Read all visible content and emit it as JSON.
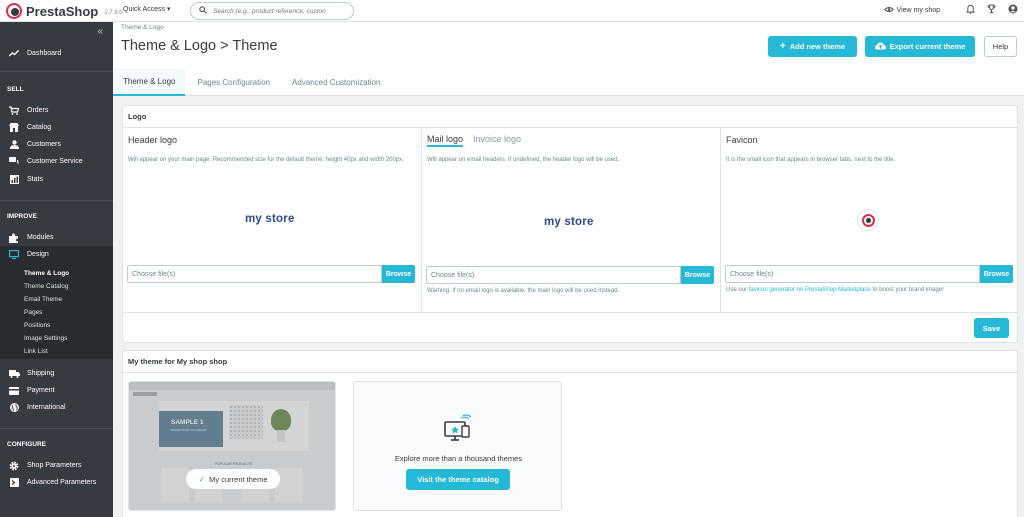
{
  "topbar": {
    "brand": "PrestaShop",
    "version": "1.7.8.0",
    "quick_access": "Quick Access",
    "search_placeholder": "Search (e.g.: product reference, custon",
    "view_shop": "View my shop"
  },
  "sidebar": {
    "dashboard": "Dashboard",
    "sell_heading": "SELL",
    "sell_items": [
      "Orders",
      "Catalog",
      "Customers",
      "Customer Service",
      "Stats"
    ],
    "improve_heading": "IMPROVE",
    "modules": "Modules",
    "design": "Design",
    "design_sub": [
      "Theme & Logo",
      "Theme Catalog",
      "Email Theme",
      "Pages",
      "Positions",
      "Image Settings",
      "Link List"
    ],
    "improve_items": [
      "Shipping",
      "Payment",
      "International"
    ],
    "configure_heading": "CONFIGURE",
    "configure_items": [
      "Shop Parameters",
      "Advanced Parameters"
    ]
  },
  "header": {
    "breadcrumb": "Theme & Logo",
    "title": "Theme & Logo > Theme",
    "add_theme": "Add new theme",
    "export_theme": "Export current theme",
    "help": "Help",
    "tabs": [
      "Theme & Logo",
      "Pages Configuration",
      "Advanced Customization"
    ]
  },
  "logo_panel": {
    "heading": "Logo",
    "header_logo": {
      "title": "Header logo",
      "desc": "Will appear on your main page. Recommended size for the default theme: height 40px and width 200px.",
      "file_label": "Choose file(s)",
      "browse": "Browse"
    },
    "mail_logo": {
      "tab_mail": "Mail logo",
      "tab_invoice": "Invoice logo",
      "desc": "Will appear on email headers. If undefined, the header logo will be used.",
      "file_label": "Choose file(s)",
      "browse": "Browse",
      "warning": "Warning: if no email logo is available, the main logo will be used instead."
    },
    "favicon": {
      "title": "Favicon",
      "desc": "It is the small icon that appears in browser tabs, next to the title.",
      "file_label": "Choose file(s)",
      "browse": "Browse",
      "hint_before": "Use our",
      "hint_link": "favicon generator on PrestaShop Marketplace",
      "hint_after": "to boost your brand image!"
    },
    "store_logo_text": "my store",
    "save": "Save"
  },
  "theme_panel": {
    "heading": "My theme for My shop shop",
    "current_theme": "My current theme",
    "thumb_banner": "SAMPLE 1",
    "thumb_sub": "EXCEPTEUR OCCAECAT",
    "thumb_popular": "POPULAR PRODUCTS",
    "explore_text": "Explore more than a thousand themes",
    "visit_catalog": "Visit the theme catalog"
  },
  "colors": {
    "accent": "#25b9d7",
    "sidebar": "#363a41",
    "brand_red": "#dd2d4a"
  }
}
